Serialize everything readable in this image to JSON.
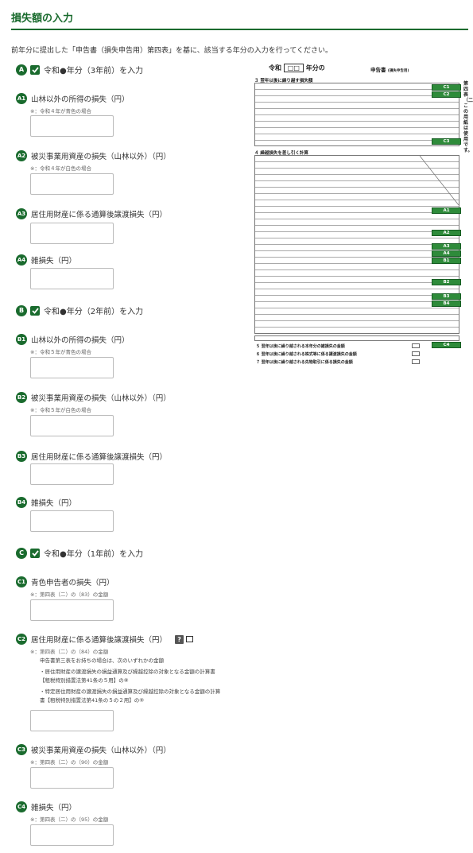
{
  "page": {
    "title": "損失額の入力",
    "intro": "前年分に提出した「申告書（損失申告用）第四表」を基に、該当する年分の入力を行ってください。"
  },
  "sections": {
    "A": {
      "badge": "A",
      "label": "令和●年分（3年前）を入力",
      "checked": true
    },
    "B": {
      "badge": "B",
      "label": "令和●年分（2年前）を入力",
      "checked": true
    },
    "C": {
      "badge": "C",
      "label": "令和●年分（1年前）を入力",
      "checked": true
    }
  },
  "fields": {
    "A1": {
      "badge": "A1",
      "label": "山林以外の所得の損失（円）",
      "note": "※：令和４年が青色の場合",
      "value": ""
    },
    "A2": {
      "badge": "A2",
      "label": "被災事業用資産の損失（山林以外）（円）",
      "note": "※：令和４年が白色の場合",
      "value": ""
    },
    "A3": {
      "badge": "A3",
      "label": "居住用財産に係る通算後譲渡損失（円）",
      "note": "",
      "value": ""
    },
    "A4": {
      "badge": "A4",
      "label": "雑損失（円）",
      "note": "",
      "value": ""
    },
    "B1": {
      "badge": "B1",
      "label": "山林以外の所得の損失（円）",
      "note": "※：令和５年が青色の場合",
      "value": ""
    },
    "B2": {
      "badge": "B2",
      "label": "被災事業用資産の損失（山林以外）（円）",
      "note": "※：令和５年が白色の場合",
      "value": ""
    },
    "B3": {
      "badge": "B3",
      "label": "居住用財産に係る通算後譲渡損失（円）",
      "note": "",
      "value": ""
    },
    "B4": {
      "badge": "B4",
      "label": "雑損失（円）",
      "note": "",
      "value": ""
    },
    "C1": {
      "badge": "C1",
      "label": "青色申告者の損失（円）",
      "note": "※：第四表（二）の（83）の金額",
      "value": ""
    },
    "C2": {
      "badge": "C2",
      "label": "居住用財産に係る通算後譲渡損失（円）",
      "note": "※：第四表（二）の（84）の金額",
      "value": "",
      "help_icon": "?",
      "extra": [
        "申告書第三表をお持ちの場合は、次のいずれかの金額",
        "・居住用財産の譲渡損失の損益通算及び繰越控除の対象となる金額の計算書",
        "【租税特別措置法第41条の５用】の⑧",
        "・特定居住用財産の譲渡損失の損益通算及び繰越控除の対象となる金額の計算",
        "書【租税特別措置法第41条の５の２用】の⑨"
      ]
    },
    "C3": {
      "badge": "C3",
      "label": "被災事業用資産の損失（山林以外）（円）",
      "note": "※：第四表（二）の（90）の金額",
      "value": ""
    },
    "C4": {
      "badge": "C4",
      "label": "雑損失（円）",
      "note": "※：第四表（二）の（95）の金額",
      "value": ""
    }
  },
  "form_preview": {
    "title_left": "令和",
    "title_mid": "年分の",
    "title_right": "申告書",
    "title_right_small": "(損失申告用)",
    "section3": "３ 翌年以後に繰り越す損失額",
    "section4": "４ 繰越損失を差し引く計算",
    "row5": "５ 翌年以後に繰り越される本年分の雑損失の金額",
    "row6": "６ 翌年以後に繰り越される株式等に係る譲渡損失の金額",
    "row7": "７ 翌年以後に繰り越される先物取引に係る損失の金額",
    "side_text": "第四表（二）この用紙は使用です。",
    "tags": [
      "C1",
      "C2",
      "C3",
      "A1",
      "A2",
      "A3",
      "A4",
      "B1",
      "B2",
      "B3",
      "B4",
      "C4"
    ]
  },
  "colors": {
    "brand": "#1a6b2e",
    "tag": "#2e8b3a"
  }
}
